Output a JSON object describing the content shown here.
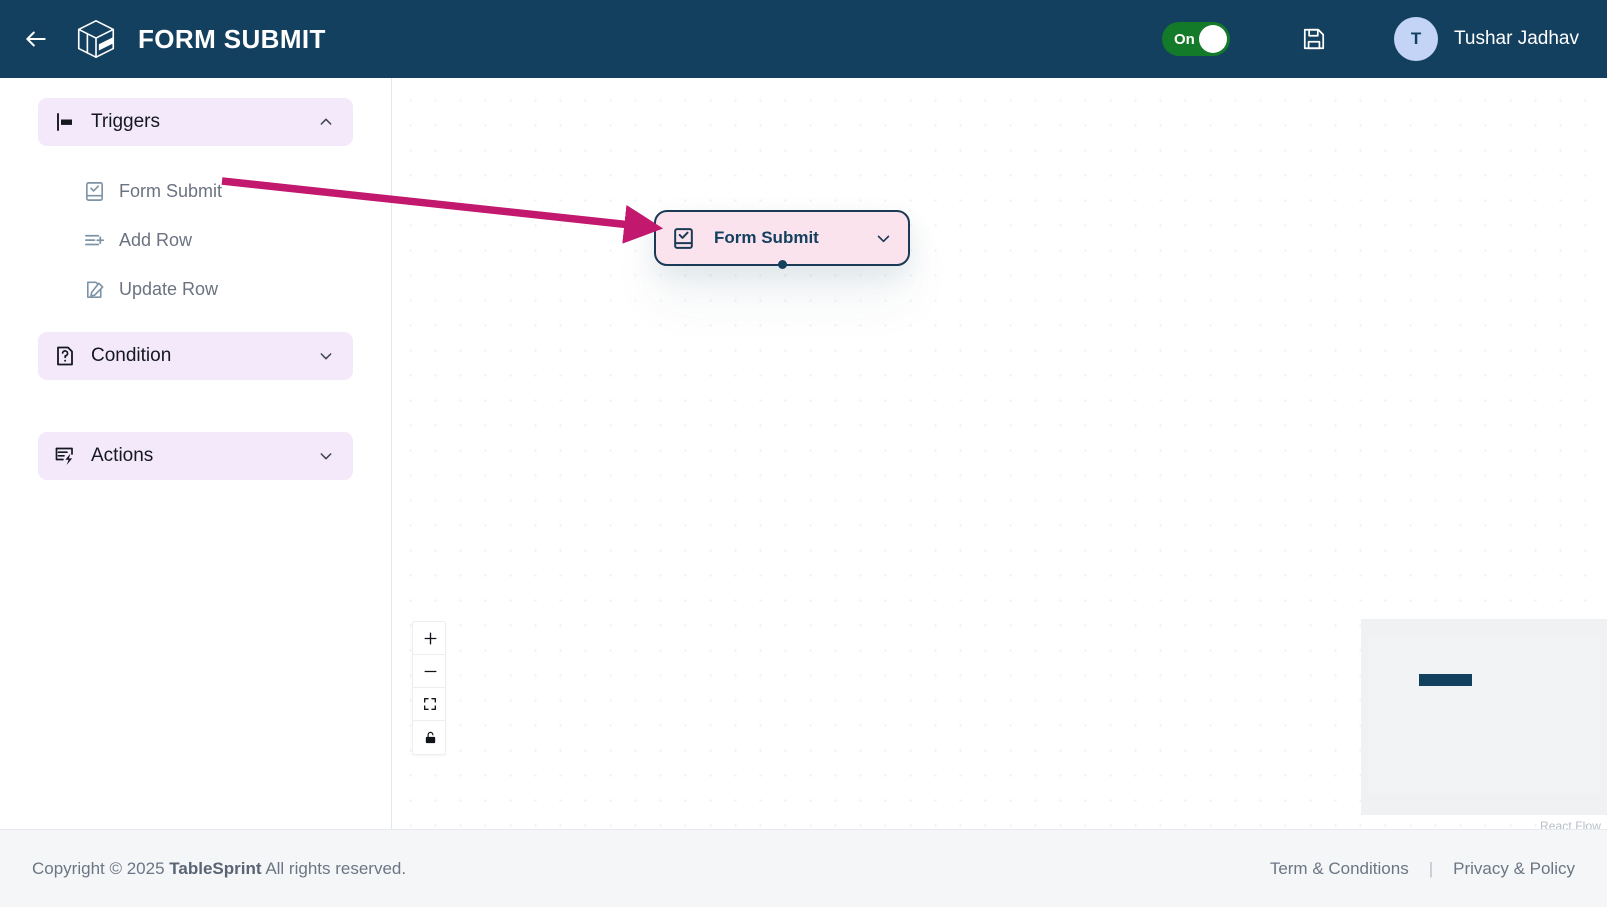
{
  "header": {
    "back_icon": "arrow-left-icon",
    "logo_icon": "cube-logo-icon",
    "title": "FORM SUBMIT",
    "toggle": {
      "label": "On",
      "state": "on",
      "color": "#127a28"
    },
    "save_icon": "floppy-save-icon",
    "user": {
      "initial": "T",
      "name": "Tushar Jadhav",
      "avatar_color": "#c3d4f7"
    },
    "bg_color": "#14405f"
  },
  "sidebar": {
    "sections": [
      {
        "label": "Triggers",
        "icon": "flag-icon",
        "expanded": true,
        "chevron": "chevron-up-icon",
        "items": [
          {
            "label": "Form Submit",
            "icon": "form-submit-icon"
          },
          {
            "label": "Add Row",
            "icon": "add-row-icon"
          },
          {
            "label": "Update Row",
            "icon": "update-row-icon"
          }
        ]
      },
      {
        "label": "Condition",
        "icon": "question-document-icon",
        "expanded": false,
        "chevron": "chevron-down-icon",
        "items": []
      },
      {
        "label": "Actions",
        "icon": "action-lightning-icon",
        "expanded": false,
        "chevron": "chevron-down-icon",
        "items": []
      }
    ],
    "section_bg": "#f4e8fb"
  },
  "canvas": {
    "node": {
      "label": "Form Submit",
      "icon": "form-submit-icon",
      "chevron": "chevron-down-icon",
      "bg_color": "#fbe3ee",
      "border_color": "#1b3a55",
      "handle_color": "#14405f"
    },
    "annotation": {
      "type": "arrow",
      "color": "#c2186e",
      "from": "sidebar-item Form Submit",
      "to": "canvas node Form Submit"
    },
    "zoom_controls": [
      {
        "name": "zoom-in",
        "icon": "plus-icon"
      },
      {
        "name": "zoom-out",
        "icon": "minus-icon"
      },
      {
        "name": "fit-view",
        "icon": "fit-view-icon"
      },
      {
        "name": "toggle-interactivity",
        "icon": "lock-icon"
      }
    ],
    "minimap": {
      "attribution": "React Flow",
      "bg_color": "#f0f1f3",
      "node_color": "#14405f"
    }
  },
  "footer": {
    "copyright_prefix": "Copyright © 2025 ",
    "brand": "TableSprint",
    "copyright_suffix": " All rights reserved.",
    "links": [
      {
        "label": "Term & Conditions"
      },
      {
        "label": "Privacy & Policy"
      }
    ],
    "separator": "|"
  }
}
